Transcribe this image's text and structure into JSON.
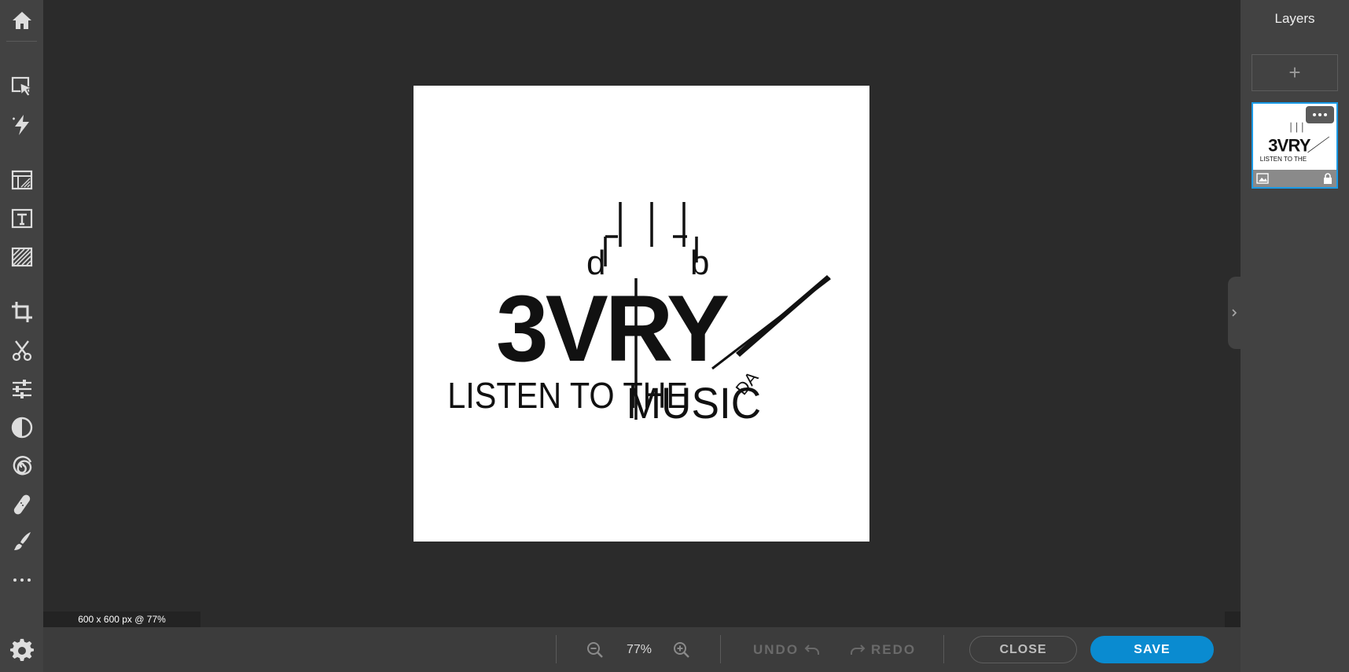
{
  "toolbar": {
    "items": [
      {
        "name": "home-icon"
      },
      {
        "name": "select-arrange-icon"
      },
      {
        "name": "auto-fix-icon"
      },
      {
        "name": "layout-templates-icon"
      },
      {
        "name": "text-tool-icon"
      },
      {
        "name": "pattern-fill-icon"
      },
      {
        "name": "crop-icon"
      },
      {
        "name": "cutout-scissors-icon"
      },
      {
        "name": "adjustments-sliders-icon"
      },
      {
        "name": "contrast-effects-icon"
      },
      {
        "name": "distort-swirl-icon"
      },
      {
        "name": "heal-bandage-icon"
      },
      {
        "name": "paint-brush-icon"
      },
      {
        "name": "more-tools-icon"
      }
    ],
    "settings": "gear-icon"
  },
  "canvas": {
    "status": "600 x 600 px @ 77%",
    "logo_lines": [
      "3VRY",
      "LISTEN TO THE",
      "MUSIC",
      "DA"
    ]
  },
  "bottombar": {
    "zoom_value": "77%",
    "undo_label": "UNDO",
    "redo_label": "REDO",
    "close_label": "CLOSE",
    "save_label": "SAVE"
  },
  "layers": {
    "title": "Layers",
    "add_label": "+"
  },
  "colors": {
    "accent": "#0a8bd0",
    "selected_border": "#1a9ae6",
    "panel_bg": "#424242",
    "canvas_bg": "#2b2b2b"
  }
}
